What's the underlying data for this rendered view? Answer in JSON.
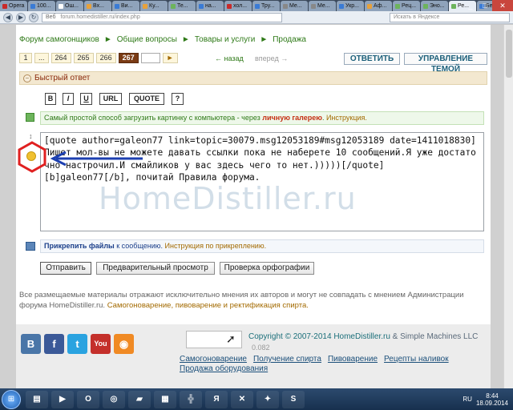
{
  "browser": {
    "tabs": [
      {
        "label": "Opera",
        "color": "#c92a2a"
      },
      {
        "label": "100...",
        "color": "#3a7bd5"
      },
      {
        "label": "Ош...",
        "color": "#ffffff"
      },
      {
        "label": "Вх...",
        "color": "#e8a13a"
      },
      {
        "label": "Ви...",
        "color": "#3a7bd5"
      },
      {
        "label": "Ку...",
        "color": "#e8a13a"
      },
      {
        "label": "Те...",
        "color": "#6db45c"
      },
      {
        "label": "на...",
        "color": "#3a7bd5"
      },
      {
        "label": "хол...",
        "color": "#c92a2a"
      },
      {
        "label": "Тру...",
        "color": "#3a7bd5"
      },
      {
        "label": "Ме...",
        "color": "#888888"
      },
      {
        "label": "Ме...",
        "color": "#888888"
      },
      {
        "label": "Укр...",
        "color": "#3a7bd5"
      },
      {
        "label": "Аф...",
        "color": "#e8a13a"
      },
      {
        "label": "Рец...",
        "color": "#6db45c"
      },
      {
        "label": "Эно...",
        "color": "#6db45c"
      },
      {
        "label": "Ре...",
        "color": "#6db45c"
      },
      {
        "label": "Бе...",
        "color": "#3a7bd5"
      },
      {
        "label": "Ви...",
        "color": "#3a7bd5"
      }
    ],
    "url_proto": "Веб",
    "url": "forum.homedistiller.ru/index.php",
    "search_placeholder": "Искать в Яндексе"
  },
  "breadcrumb": {
    "items": [
      "Форум самогонщиков",
      "Общие вопросы",
      "Товары и услуги",
      "Продажа"
    ],
    "separator": "►"
  },
  "pager": {
    "pages": [
      "1",
      "...",
      "264",
      "265",
      "266"
    ],
    "current": "267",
    "go": "►",
    "back": "← назад",
    "forward": "вперед →",
    "reply_button": "ОТВЕТИТЬ",
    "manage_button": "УПРАВЛЕНИЕ ТЕМОЙ"
  },
  "quick_reply": {
    "title": "Быстрый ответ",
    "toggle": "–"
  },
  "format_buttons": [
    "B",
    "I",
    "U",
    "URL",
    "QUOTE",
    "?"
  ],
  "gallery_info": {
    "text1": "Самый простой способ загрузить картинку с компьютера - через ",
    "highlight": "личную галерею",
    "text2": ". ",
    "link": "Инструкция."
  },
  "editor": {
    "text": "[quote author=galeon77 link=topic=30079.msg12053189#msg12053189 date=1411018830]Пишет мол-вы не можете давать ссылки пока не наберете 10 сообщений.Я уже достаточно настрочил.И смайликов у вас здесь чего то нет.)))))[/quote]\n[b]galeon77[/b], почитай Правила форума.",
    "watermark": "HomeDistiller.ru"
  },
  "attach": {
    "bold": "Прикрепить файлы",
    "text": " к сообщению. ",
    "link": "Инструкция по прикреплению."
  },
  "actions": {
    "send": "Отправить",
    "preview": "Предварительный просмотр",
    "spellcheck": "Проверка орфографии"
  },
  "disclaimer": {
    "text": "Все размещаемые материалы отражают исключительно мнения их авторов и могут не совпадать с мнением Администрации форума HomeDistiller.ru. ",
    "link": "Самогоноварение, пивоварение и ректификация спирта."
  },
  "footer": {
    "social": [
      {
        "name": "vk-icon",
        "label": "B",
        "color": "#4a76a8"
      },
      {
        "name": "facebook-icon",
        "label": "f",
        "color": "#3b5998"
      },
      {
        "name": "twitter-icon",
        "label": "t",
        "color": "#2aa3e0"
      },
      {
        "name": "youtube-icon",
        "label": "You",
        "color": "#c4302b"
      },
      {
        "name": "rss-icon",
        "label": "◉",
        "color": "#f08a24"
      }
    ],
    "copyright": "Copyright © 2007-2014 HomeDistiller.ru",
    "copyright_sms": " & Simple Machines LLC",
    "rating": "0.082",
    "nav": [
      "Самогоноварение",
      "Получение спирта",
      "Пивоварение",
      "Рецепты наливок",
      "Продажа оборудования"
    ]
  },
  "taskbar": {
    "start": "⊞",
    "items": [
      {
        "name": "explorer-icon",
        "label": "▤"
      },
      {
        "name": "media-icon",
        "label": "▶"
      },
      {
        "name": "opera-icon",
        "label": "O"
      },
      {
        "name": "chrome-icon",
        "label": "◎"
      },
      {
        "name": "folder-icon",
        "label": "▰"
      },
      {
        "name": "calculator-icon",
        "label": "▦"
      },
      {
        "name": "app-icon",
        "label": "╬"
      },
      {
        "name": "yandex-icon",
        "label": "Я"
      },
      {
        "name": "hammer-icon",
        "label": "✕"
      },
      {
        "name": "yandex-browser-icon",
        "label": "✦"
      },
      {
        "name": "skype-icon",
        "label": "S"
      }
    ],
    "lang": "RU",
    "time": "8:44",
    "date": "18.09.2014"
  }
}
